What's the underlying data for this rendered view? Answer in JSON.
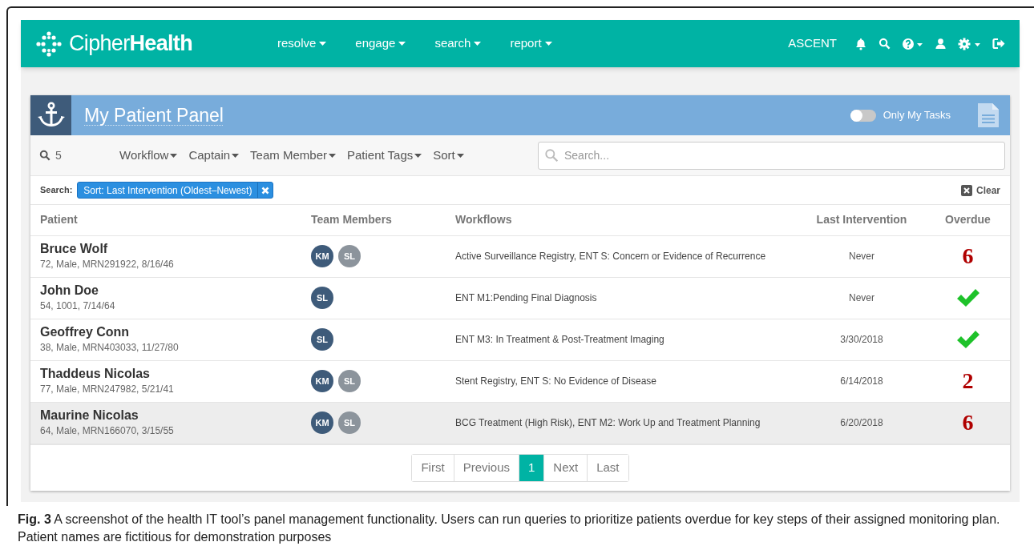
{
  "navbar": {
    "logo_light": "Cipher",
    "logo_bold": "Health",
    "menus": [
      "resolve",
      "engage",
      "search",
      "report"
    ],
    "org": "ASCENT"
  },
  "panel": {
    "title": "My Patient Panel",
    "toggle": {
      "label": "Only My Tasks",
      "on": false
    },
    "count": "5",
    "filters": [
      "Workflow",
      "Captain",
      "Team Member",
      "Patient Tags",
      "Sort"
    ],
    "search": {
      "placeholder": "Search..."
    },
    "search_label": "Search:",
    "chips": [
      "Sort: Last Intervention (Oldest–Newest)"
    ],
    "clear": "Clear",
    "columns": [
      "Patient",
      "Team Members",
      "Workflows",
      "Last Intervention",
      "Overdue"
    ],
    "rows": [
      {
        "name": "Bruce Wolf",
        "details": "72, Male, MRN291922, 8/16/46",
        "members": [
          {
            "initials": "KM",
            "color": "#3e5b7a"
          },
          {
            "initials": "SL",
            "color": "#8c949c"
          }
        ],
        "workflows": "Active Surveillance Registry, ENT S: Concern or Evidence of Recurrence",
        "last": "Never",
        "overdue": {
          "kind": "count",
          "text": "6"
        },
        "hovered": false
      },
      {
        "name": "John Doe",
        "details": "54, 1001, 7/14/64",
        "members": [
          {
            "initials": "SL",
            "color": "#3e5b7a"
          }
        ],
        "workflows": "ENT M1:Pending Final Diagnosis",
        "last": "Never",
        "overdue": {
          "kind": "ok"
        },
        "hovered": false
      },
      {
        "name": "Geoffrey Conn",
        "details": "38, Male, MRN403033, 11/27/80",
        "members": [
          {
            "initials": "SL",
            "color": "#3e5b7a"
          }
        ],
        "workflows": "ENT M3: In Treatment & Post-Treatment Imaging",
        "last": "3/30/2018",
        "overdue": {
          "kind": "ok"
        },
        "hovered": false
      },
      {
        "name": "Thaddeus Nicolas",
        "details": "77, Male, MRN247982, 5/21/41",
        "members": [
          {
            "initials": "KM",
            "color": "#3e5b7a"
          },
          {
            "initials": "SL",
            "color": "#8c949c"
          }
        ],
        "workflows": "Stent Registry, ENT S: No Evidence of Disease",
        "last": "6/14/2018",
        "overdue": {
          "kind": "count",
          "text": "2"
        },
        "hovered": false
      },
      {
        "name": "Maurine Nicolas",
        "details": "64, Male, MRN166070, 3/15/55",
        "members": [
          {
            "initials": "KM",
            "color": "#3e5b7a"
          },
          {
            "initials": "SL",
            "color": "#8c949c"
          }
        ],
        "workflows": "BCG Treatment (High Risk), ENT M2: Work Up and Treatment Planning",
        "last": "6/20/2018",
        "overdue": {
          "kind": "count",
          "text": "6"
        },
        "hovered": true
      }
    ],
    "pagination": [
      {
        "label": "First",
        "selected": false
      },
      {
        "label": "Previous",
        "selected": false
      },
      {
        "label": "1",
        "selected": true
      },
      {
        "label": "Next",
        "selected": false
      },
      {
        "label": "Last",
        "selected": false
      }
    ]
  },
  "caption": "**Fig. 3** A screenshot of the health IT tool’s panel management functionality. Users can run queries to prioritize patients overdue for key steps of their assigned monitoring plan. Patient names are fictitious for demonstration purposes"
}
